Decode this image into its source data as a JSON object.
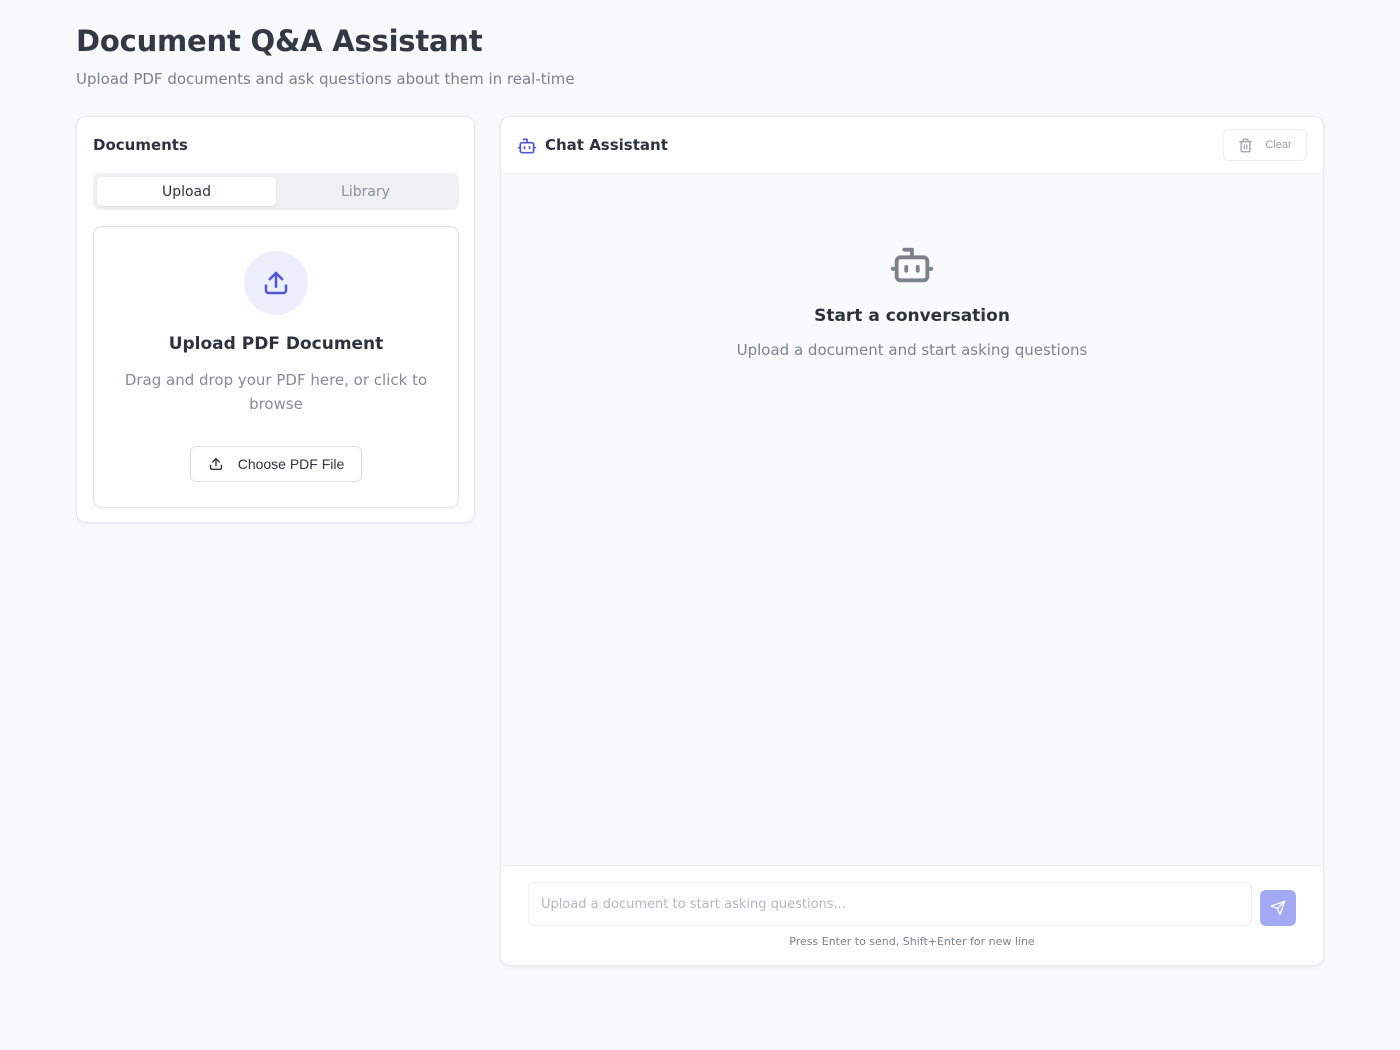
{
  "header": {
    "title": "Document Q&A Assistant",
    "subtitle": "Upload PDF documents and ask questions about them in real-time"
  },
  "documents": {
    "title": "Documents",
    "tabs": [
      {
        "label": "Upload",
        "active": true
      },
      {
        "label": "Library",
        "active": false
      }
    ],
    "upload": {
      "icon": "upload-icon",
      "heading": "Upload PDF Document",
      "description": "Drag and drop your PDF here, or click to browse",
      "button_label": "Choose PDF File"
    }
  },
  "chat": {
    "title": "Chat Assistant",
    "icon": "bot-icon",
    "clear_label": "Clear",
    "empty_state": {
      "title": "Start a conversation",
      "description": "Upload a document and start asking questions"
    },
    "input": {
      "value": "",
      "placeholder": "Upload a document to start asking questions..."
    },
    "send_icon": "send-icon",
    "hint": "Press Enter to send, Shift+Enter for new line"
  },
  "colors": {
    "accent": "#4f55d6",
    "accent_light": "#eceefc",
    "send_button": "#a3a9f5",
    "background": "#f8f9fb"
  }
}
